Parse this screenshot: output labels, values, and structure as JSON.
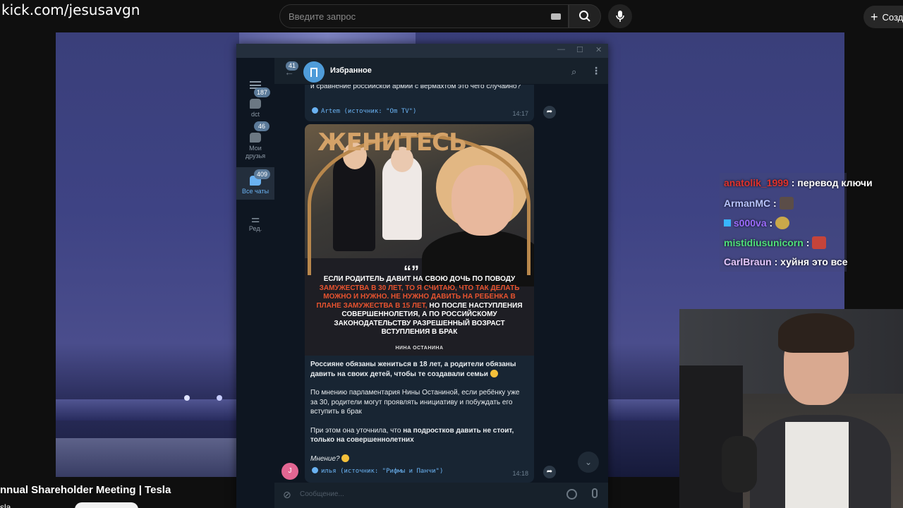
{
  "overlay": {
    "url": "kick.com/jesusavgn"
  },
  "youtube": {
    "search_placeholder": "Введите запрос",
    "create_label": "Созд",
    "video_title": "nnual Shareholder Meeting | Tesla",
    "channel": "sla"
  },
  "telegram": {
    "sidebar": [
      {
        "label": "dct",
        "badge": "187"
      },
      {
        "label": "Мои друзья",
        "badge": "46"
      },
      {
        "label": "Все чаты",
        "badge": "409",
        "active": true
      },
      {
        "label": "Ред.",
        "badge": ""
      }
    ],
    "header": {
      "back_badge": "41",
      "chat_name": "Избранное"
    },
    "msg1": {
      "text": "и сравнение российской армии с вермахтом это чего случайно?",
      "source": "Artem (источник: \"Om TV\")",
      "time": "14:17"
    },
    "msg2": {
      "poster_headline": "ЖЕНИТЕСЬ",
      "quote_mark": "“”",
      "quote_white_1": "ЕСЛИ РОДИТЕЛЬ ДАВИТ НА СВОЮ ДОЧЬ ПО ПОВОДУ",
      "quote_red": "ЗАМУЖЕСТВА В 30 ЛЕТ, ТО Я СЧИТАЮ, ЧТО ТАК ДЕЛАТЬ МОЖНО И НУЖНО. НЕ НУЖНО ДАВИТЬ НА РЕБЕНКА В ПЛАНЕ ЗАМУЖЕСТВА В 15 ЛЕТ,",
      "quote_white_2": "НО ПОСЛЕ НАСТУПЛЕНИЯ СОВЕРШЕННОЛЕТИЯ, А ПО РОССИЙСКОМУ ЗАКОНОДАТЕЛЬСТВУ РАЗРЕШЕННЫЙ ВОЗРАСТ ВСТУПЛЕНИЯ В БРАК",
      "author": "НИНА ОСТАНИНА",
      "p1": "Россияне обязаны жениться в 18 лет, а родители обязаны давить на своих детей, чтобы те создавали семьи",
      "p2": "По мнению парламентария Нины Останиной, если ребёнку уже за 30, родители могут проявлять инициативу и побуждать его вступить в брак",
      "p3a": "При этом она уточнила, что ",
      "p3b": "на подростков давить не стоит, только на совершеннолетних",
      "p4": "Мнение?",
      "source": "илья (источник: \"Рифмы и Панчи\")",
      "time": "14:18",
      "avatar_letter": "J"
    },
    "compose_placeholder": "Сообщение..."
  },
  "chat": [
    {
      "user": "anatolik_1999",
      "text": ": перевод ключи"
    },
    {
      "user": "ArmanMC",
      "text": ":"
    },
    {
      "user": "s000va",
      "text": ":"
    },
    {
      "user": "mistidiusunicorn",
      "text": ":"
    },
    {
      "user": "CarlBraun",
      "text": ": хуйня это все"
    }
  ]
}
